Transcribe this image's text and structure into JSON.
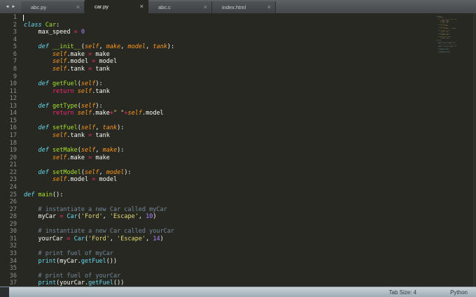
{
  "tabbar": {
    "nav_left": "◄",
    "nav_right": "►",
    "tabs": [
      {
        "label": "abc.py",
        "close": "×",
        "active": false
      },
      {
        "label": "car.py",
        "close": "×",
        "active": true
      },
      {
        "label": "abc.c",
        "close": "×",
        "active": false
      },
      {
        "label": "index.html",
        "close": "×",
        "active": false
      }
    ]
  },
  "editor": {
    "line_count": 37,
    "language": "Python",
    "lines": [
      [],
      [
        [
          "kw",
          "class"
        ],
        [
          "plain",
          " "
        ],
        [
          "fn",
          "Car"
        ],
        [
          "plain",
          ":"
        ]
      ],
      [
        [
          "plain",
          "    max_speed "
        ],
        [
          "op",
          "="
        ],
        [
          "plain",
          " "
        ],
        [
          "num",
          "0"
        ]
      ],
      [],
      [
        [
          "plain",
          "    "
        ],
        [
          "kw",
          "def"
        ],
        [
          "plain",
          " "
        ],
        [
          "fn",
          "__init__"
        ],
        [
          "plain",
          "("
        ],
        [
          "param",
          "self"
        ],
        [
          "plain",
          ", "
        ],
        [
          "param",
          "make"
        ],
        [
          "plain",
          ", "
        ],
        [
          "param",
          "model"
        ],
        [
          "plain",
          ", "
        ],
        [
          "param",
          "tank"
        ],
        [
          "plain",
          "):"
        ]
      ],
      [
        [
          "plain",
          "        "
        ],
        [
          "self",
          "self"
        ],
        [
          "plain",
          ".make "
        ],
        [
          "op",
          "="
        ],
        [
          "plain",
          " make"
        ]
      ],
      [
        [
          "plain",
          "        "
        ],
        [
          "self",
          "self"
        ],
        [
          "plain",
          ".model "
        ],
        [
          "op",
          "="
        ],
        [
          "plain",
          " model"
        ]
      ],
      [
        [
          "plain",
          "        "
        ],
        [
          "self",
          "self"
        ],
        [
          "plain",
          ".tank "
        ],
        [
          "op",
          "="
        ],
        [
          "plain",
          " tank"
        ]
      ],
      [],
      [
        [
          "plain",
          "    "
        ],
        [
          "kw",
          "def"
        ],
        [
          "plain",
          " "
        ],
        [
          "fn",
          "getFuel"
        ],
        [
          "plain",
          "("
        ],
        [
          "param",
          "self"
        ],
        [
          "plain",
          "):"
        ]
      ],
      [
        [
          "plain",
          "        "
        ],
        [
          "op",
          "return"
        ],
        [
          "plain",
          " "
        ],
        [
          "self",
          "self"
        ],
        [
          "plain",
          ".tank"
        ]
      ],
      [],
      [
        [
          "plain",
          "    "
        ],
        [
          "kw",
          "def"
        ],
        [
          "plain",
          " "
        ],
        [
          "fn",
          "getType"
        ],
        [
          "plain",
          "("
        ],
        [
          "param",
          "self"
        ],
        [
          "plain",
          "):"
        ]
      ],
      [
        [
          "plain",
          "        "
        ],
        [
          "op",
          "return"
        ],
        [
          "plain",
          " "
        ],
        [
          "self",
          "self"
        ],
        [
          "plain",
          ".make"
        ],
        [
          "op",
          "+"
        ],
        [
          "str",
          "\" \""
        ],
        [
          "op",
          "+"
        ],
        [
          "self",
          "self"
        ],
        [
          "plain",
          ".model"
        ]
      ],
      [],
      [
        [
          "plain",
          "    "
        ],
        [
          "kw",
          "def"
        ],
        [
          "plain",
          " "
        ],
        [
          "fn",
          "setFuel"
        ],
        [
          "plain",
          "("
        ],
        [
          "param",
          "self"
        ],
        [
          "plain",
          ", "
        ],
        [
          "param",
          "tank"
        ],
        [
          "plain",
          "):"
        ]
      ],
      [
        [
          "plain",
          "        "
        ],
        [
          "self",
          "self"
        ],
        [
          "plain",
          ".tank "
        ],
        [
          "op",
          "="
        ],
        [
          "plain",
          " tank"
        ]
      ],
      [],
      [
        [
          "plain",
          "    "
        ],
        [
          "kw",
          "def"
        ],
        [
          "plain",
          " "
        ],
        [
          "fn",
          "setMake"
        ],
        [
          "plain",
          "("
        ],
        [
          "param",
          "self"
        ],
        [
          "plain",
          ", "
        ],
        [
          "param",
          "make"
        ],
        [
          "plain",
          "):"
        ]
      ],
      [
        [
          "plain",
          "        "
        ],
        [
          "self",
          "self"
        ],
        [
          "plain",
          ".make "
        ],
        [
          "op",
          "="
        ],
        [
          "plain",
          " make"
        ]
      ],
      [],
      [
        [
          "plain",
          "    "
        ],
        [
          "kw",
          "def"
        ],
        [
          "plain",
          " "
        ],
        [
          "fn",
          "setModel"
        ],
        [
          "plain",
          "("
        ],
        [
          "param",
          "self"
        ],
        [
          "plain",
          ", "
        ],
        [
          "param",
          "model"
        ],
        [
          "plain",
          "):"
        ]
      ],
      [
        [
          "plain",
          "        "
        ],
        [
          "self",
          "self"
        ],
        [
          "plain",
          ".model "
        ],
        [
          "op",
          "="
        ],
        [
          "plain",
          " model"
        ]
      ],
      [],
      [
        [
          "kw",
          "def"
        ],
        [
          "plain",
          " "
        ],
        [
          "fn",
          "main"
        ],
        [
          "plain",
          "():"
        ]
      ],
      [],
      [
        [
          "plain",
          "    "
        ],
        [
          "comment",
          "# instantiate a new Car called myCar"
        ]
      ],
      [
        [
          "plain",
          "    myCar "
        ],
        [
          "op",
          "="
        ],
        [
          "plain",
          " "
        ],
        [
          "call",
          "Car"
        ],
        [
          "plain",
          "("
        ],
        [
          "str",
          "'Ford'"
        ],
        [
          "plain",
          ", "
        ],
        [
          "str",
          "'Escape'"
        ],
        [
          "plain",
          ", "
        ],
        [
          "num",
          "10"
        ],
        [
          "plain",
          ")"
        ]
      ],
      [],
      [
        [
          "plain",
          "    "
        ],
        [
          "comment",
          "# instantiate a new Car called yourCar"
        ]
      ],
      [
        [
          "plain",
          "    yourCar "
        ],
        [
          "op",
          "="
        ],
        [
          "plain",
          " "
        ],
        [
          "call",
          "Car"
        ],
        [
          "plain",
          "("
        ],
        [
          "str",
          "'Ford'"
        ],
        [
          "plain",
          ", "
        ],
        [
          "str",
          "'Escape'"
        ],
        [
          "plain",
          ", "
        ],
        [
          "num",
          "14"
        ],
        [
          "plain",
          ")"
        ]
      ],
      [],
      [
        [
          "plain",
          "    "
        ],
        [
          "comment",
          "# print fuel of myCar"
        ]
      ],
      [
        [
          "plain",
          "    "
        ],
        [
          "call",
          "print"
        ],
        [
          "plain",
          "("
        ],
        [
          "plain",
          "myCar."
        ],
        [
          "call",
          "getFuel"
        ],
        [
          "plain",
          "())"
        ]
      ],
      [],
      [
        [
          "plain",
          "    "
        ],
        [
          "comment",
          "# print fuel of yourCar"
        ]
      ],
      [
        [
          "plain",
          "    "
        ],
        [
          "call",
          "print"
        ],
        [
          "plain",
          "("
        ],
        [
          "plain",
          "yourCar."
        ],
        [
          "call",
          "getFuel"
        ],
        [
          "plain",
          "())"
        ]
      ]
    ]
  },
  "status": {
    "tab_size": "Tab Size: 4",
    "language": "Python"
  },
  "colors": {
    "editor_bg": "#272822",
    "text": "#f8f8f2",
    "keyword": "#66d9ef",
    "function_name": "#a6e22e",
    "parameter": "#fd971f",
    "operator": "#f92672",
    "number": "#ae81ff",
    "string": "#e6db74",
    "comment": "#75889b",
    "gutter": "#8e908c",
    "statusbar_bg": "#aebcc4"
  }
}
